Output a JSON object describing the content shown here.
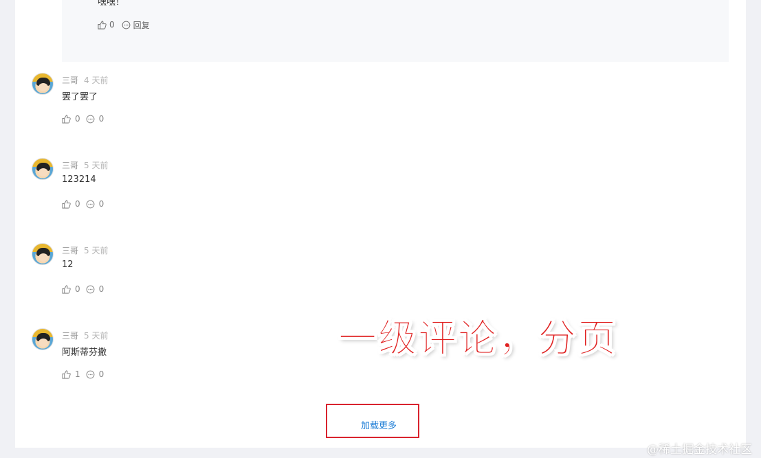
{
  "reply_section": {
    "text": "嘿嘿！",
    "like_count": "0",
    "reply_label": "回复"
  },
  "comments": [
    {
      "author": "三哥",
      "time": "4 天前",
      "content": "罢了罢了",
      "likes": "0",
      "replies": "0"
    },
    {
      "author": "三哥",
      "time": "5 天前",
      "content": "123214",
      "likes": "0",
      "replies": "0"
    },
    {
      "author": "三哥",
      "time": "5 天前",
      "content": "12",
      "likes": "0",
      "replies": "0"
    },
    {
      "author": "三哥",
      "time": "5 天前",
      "content": "阿斯蒂芬撒",
      "likes": "1",
      "replies": "0"
    }
  ],
  "overlay_title": "一级评论，分页",
  "load_more_label": "加载更多",
  "watermark": "@稀土掘金技术社区",
  "colors": {
    "accent_red": "#e02020",
    "link_blue": "#1d7dd6",
    "highlight_border": "#d9232e"
  }
}
